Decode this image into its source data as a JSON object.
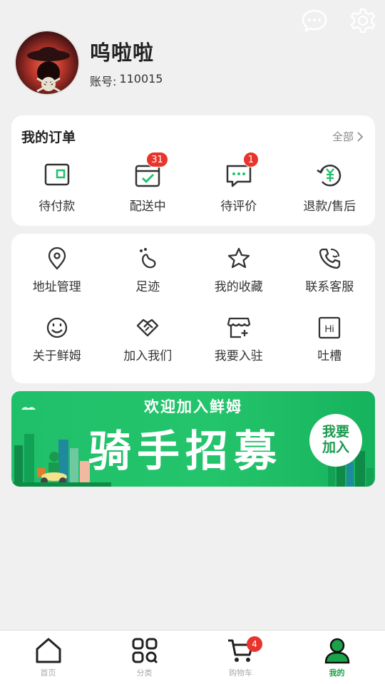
{
  "header": {
    "message_icon": "message-icon",
    "settings_icon": "settings-icon"
  },
  "profile": {
    "username": "呜啦啦",
    "account_label": "账号:",
    "account_value": "110015"
  },
  "orders": {
    "title": "我的订单",
    "all_label": "全部",
    "items": [
      {
        "label": "待付款",
        "icon": "wallet-icon",
        "badge": ""
      },
      {
        "label": "配送中",
        "icon": "delivery-box-icon",
        "badge": "31"
      },
      {
        "label": "待评价",
        "icon": "comment-icon",
        "badge": "1"
      },
      {
        "label": "退款/售后",
        "icon": "refund-icon",
        "badge": ""
      }
    ]
  },
  "services": {
    "items": [
      {
        "label": "地址管理",
        "icon": "location-icon"
      },
      {
        "label": "足迹",
        "icon": "footprint-icon"
      },
      {
        "label": "我的收藏",
        "icon": "star-icon"
      },
      {
        "label": "联系客服",
        "icon": "customer-service-icon"
      },
      {
        "label": "关于鲜姆",
        "icon": "smile-icon"
      },
      {
        "label": "加入我们",
        "icon": "handshake-icon"
      },
      {
        "label": "我要入驻",
        "icon": "storefront-icon"
      },
      {
        "label": "吐槽",
        "icon": "feedback-icon"
      }
    ]
  },
  "banner": {
    "subtitle": "欢迎加入鲜姆",
    "title": "骑手招募",
    "join_line1": "我要",
    "join_line2": "加入"
  },
  "tabbar": {
    "tabs": [
      {
        "label": "首页",
        "icon": "home-icon"
      },
      {
        "label": "分类",
        "icon": "category-icon"
      },
      {
        "label": "购物车",
        "icon": "cart-icon",
        "badge": "4"
      },
      {
        "label": "我的",
        "icon": "user-icon"
      }
    ],
    "active_color": "#1aa34a"
  },
  "colors": {
    "accent": "#1fc06a",
    "badge": "#e8342c"
  }
}
